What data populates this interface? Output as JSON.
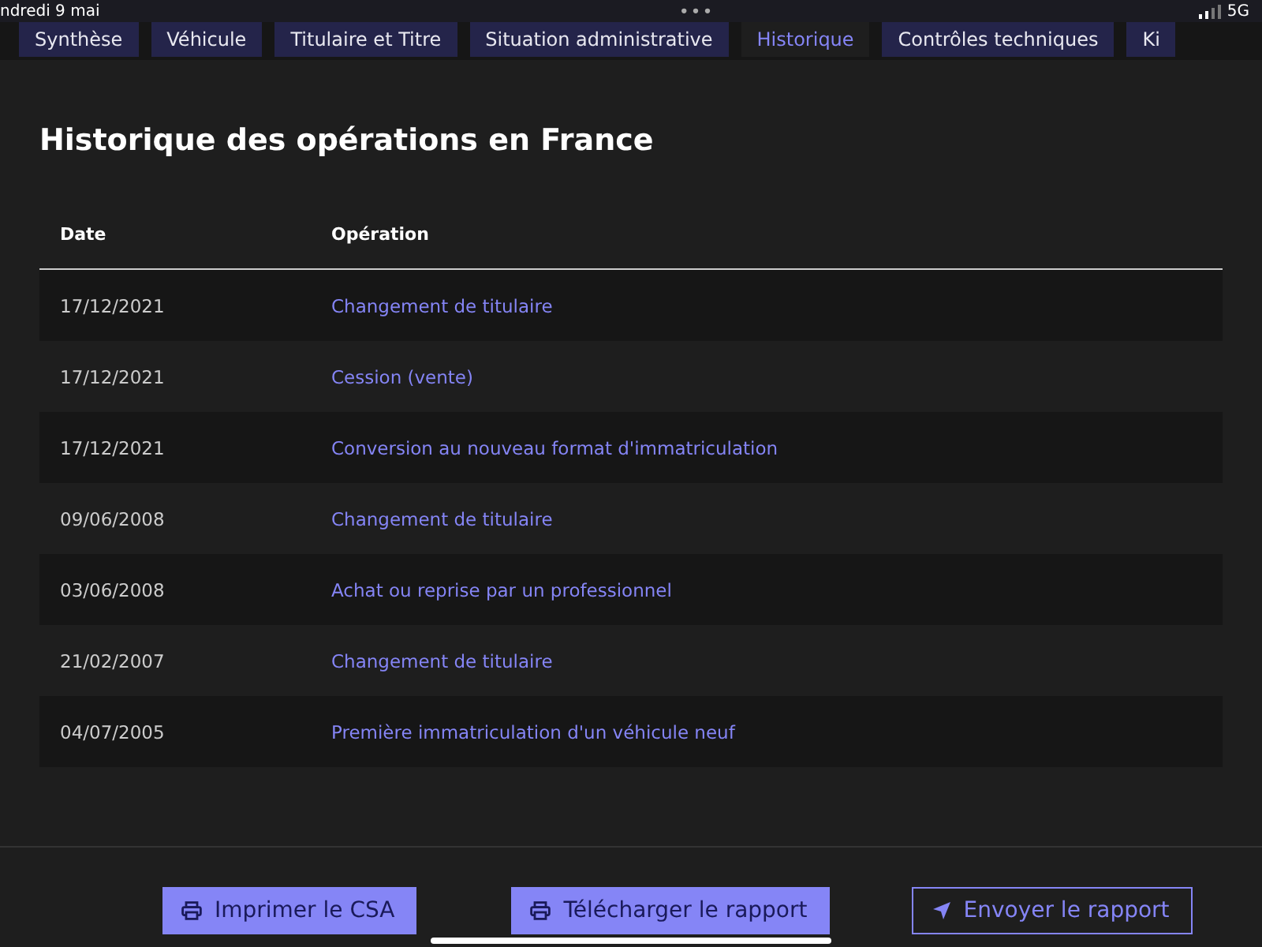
{
  "status_bar": {
    "date": "ndredi 9 mai",
    "dots": "•••",
    "network": "5G"
  },
  "tabs": [
    {
      "label": "Synthèse",
      "selected": false
    },
    {
      "label": "Véhicule",
      "selected": false
    },
    {
      "label": "Titulaire et Titre",
      "selected": false
    },
    {
      "label": "Situation administrative",
      "selected": false
    },
    {
      "label": "Historique",
      "selected": true
    },
    {
      "label": "Contrôles techniques",
      "selected": false
    },
    {
      "label": "Ki",
      "selected": false
    }
  ],
  "title": "Historique des opérations en France",
  "table": {
    "columns": [
      "Date",
      "Opération"
    ],
    "rows": [
      {
        "date": "17/12/2021",
        "operation": "Changement de titulaire"
      },
      {
        "date": "17/12/2021",
        "operation": "Cession (vente)"
      },
      {
        "date": "17/12/2021",
        "operation": "Conversion au nouveau format d'immatriculation"
      },
      {
        "date": "09/06/2008",
        "operation": "Changement de titulaire"
      },
      {
        "date": "03/06/2008",
        "operation": "Achat ou reprise par un professionnel"
      },
      {
        "date": "21/02/2007",
        "operation": "Changement de titulaire"
      },
      {
        "date": "04/07/2005",
        "operation": "Première immatriculation d'un véhicule neuf"
      }
    ]
  },
  "buttons": [
    {
      "label": "Imprimer le CSA",
      "kind": "print"
    },
    {
      "label": "Télécharger le rapport",
      "kind": "download"
    },
    {
      "label": "Envoyer le rapport",
      "kind": "send"
    }
  ]
}
